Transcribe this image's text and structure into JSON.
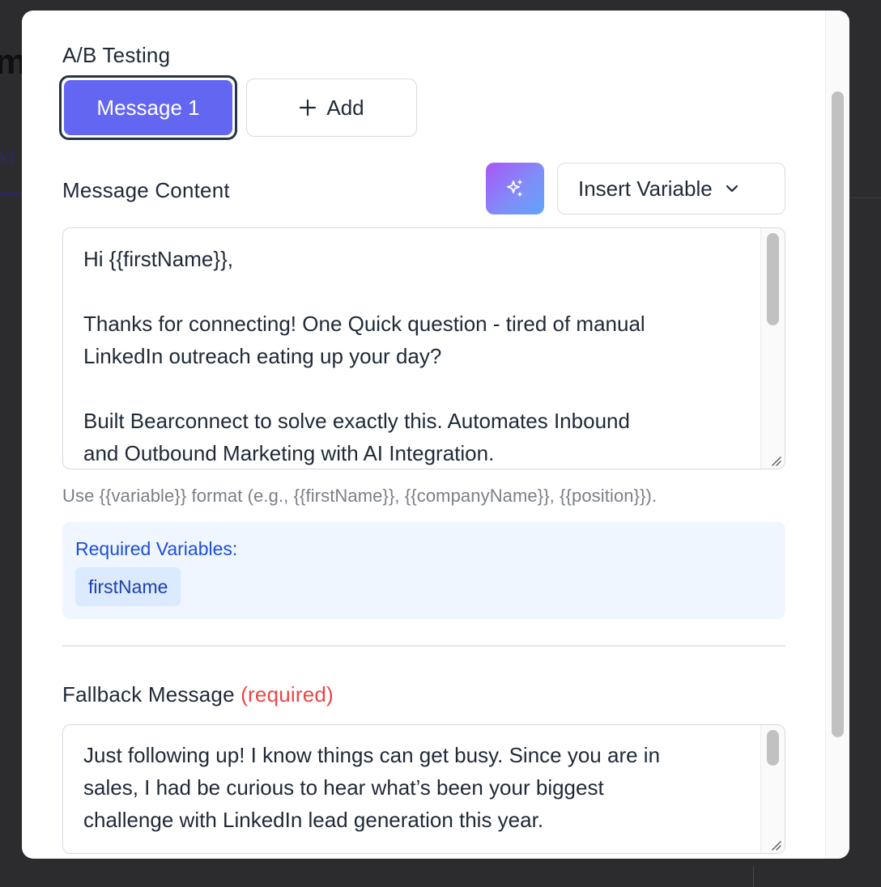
{
  "background": {
    "page_title_fragment": "m",
    "tab_fragment": "kf"
  },
  "ab_testing": {
    "label": "A/B Testing",
    "tabs": [
      {
        "label": "Message 1",
        "selected": true
      }
    ],
    "add_label": "Add"
  },
  "message_content": {
    "label": "Message Content",
    "ai_icon": "sparkles-icon",
    "insert_variable_label": "Insert Variable",
    "text": "Hi {{firstName}},\n\nThanks for connecting! One Quick question - tired of manual\nLinkedIn outreach eating up your day?\n\nBuilt Bearconnect to solve exactly this. Automates Inbound\nand Outbound Marketing with AI Integration.",
    "hint": "Use {{variable}} format (e.g., {{firstName}}, {{companyName}}, {{position}})."
  },
  "required_variables": {
    "title": "Required Variables:",
    "items": [
      "firstName"
    ]
  },
  "fallback": {
    "label": "Fallback Message",
    "required_tag": "(required)",
    "text": "Just following up! I know things can get busy. Since you are in\nsales, I had be curious to hear what’s been your biggest\nchallenge with LinkedIn lead generation this year."
  },
  "colors": {
    "primary": "#6366f1",
    "required_red": "#ef4444",
    "info_bg": "#eff6ff",
    "info_text": "#1d4ed8"
  }
}
